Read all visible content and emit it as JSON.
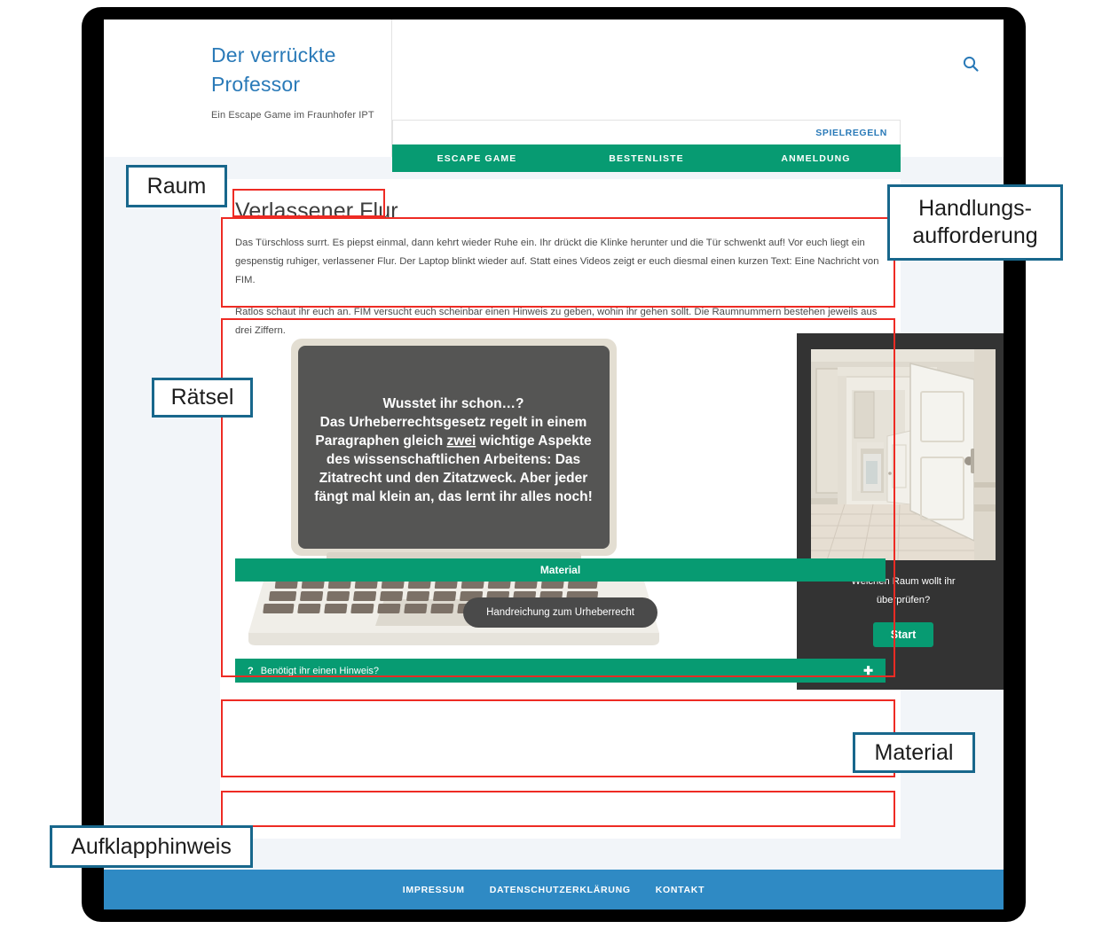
{
  "site": {
    "brand_title": "Der verrückte Professor",
    "brand_subtitle": "Ein Escape Game im Fraunhofer IPT",
    "search_icon": "search-icon",
    "top_nav": [
      {
        "label": "SPIELREGELN"
      }
    ],
    "main_nav": [
      {
        "label": "ESCAPE GAME"
      },
      {
        "label": "BESTENLISTE"
      },
      {
        "label": "ANMELDUNG"
      }
    ]
  },
  "page": {
    "title": "Verlassener Flur",
    "paragraphs": [
      "Das Türschloss surrt. Es piepst einmal, dann kehrt wieder Ruhe ein. Ihr drückt die Klinke herunter und die Tür schwenkt auf! Vor euch liegt ein gespenstig ruhiger, verlassener Flur. Der Laptop blinkt wieder auf. Statt eines Videos zeigt er euch diesmal einen kurzen Text: Eine Nachricht von FIM.",
      "Ratlos schaut ihr euch an. FIM versucht euch scheinbar einen Hinweis zu geben, wohin ihr gehen sollt. Die Raumnummern bestehen jeweils aus drei Ziffern."
    ]
  },
  "laptop": {
    "screen_lines": [
      "Wusstet ihr schon…?",
      "Das Urheberrechtsgesetz regelt in einem",
      "Paragraphen gleich zwei wichtige Aspekte",
      "des wissenschaftlichen Arbeitens: Das",
      "Zitatrecht und den Zitatzweck. Aber jeder",
      "fängt mal klein an, das lernt ihr alles noch!"
    ],
    "underlined_word": "zwei"
  },
  "cta": {
    "image_alt": "open-door-hallway-photo",
    "question_line1": "Welchen Raum wollt ihr",
    "question_line2": "überprüfen?",
    "button_label": "Start"
  },
  "material": {
    "heading": "Material",
    "button_label": "Handreichung zum Urheberrecht"
  },
  "hint": {
    "icon": "question-mark-icon",
    "label": "Benötigt ihr einen Hinweis?",
    "expand_icon": "plus-icon"
  },
  "footer": {
    "links": [
      {
        "label": "IMPRESSUM"
      },
      {
        "label": "DATENSCHUTZERKLÄRUNG"
      },
      {
        "label": "KONTAKT"
      }
    ]
  },
  "annotations": [
    {
      "label": "Raum"
    },
    {
      "label": "Handlungs-\naufforderung"
    },
    {
      "label": "Rätsel"
    },
    {
      "label": "Material"
    },
    {
      "label": "Aufklapphinweis"
    }
  ],
  "colors": {
    "brand_blue": "#2a7ab8",
    "nav_green": "#079b72",
    "footer_blue": "#2f8ac4",
    "annotation_red": "#ee2b24",
    "callout_border": "#18678c",
    "page_bg": "#f2f5f9",
    "dark_panel": "#333333"
  }
}
